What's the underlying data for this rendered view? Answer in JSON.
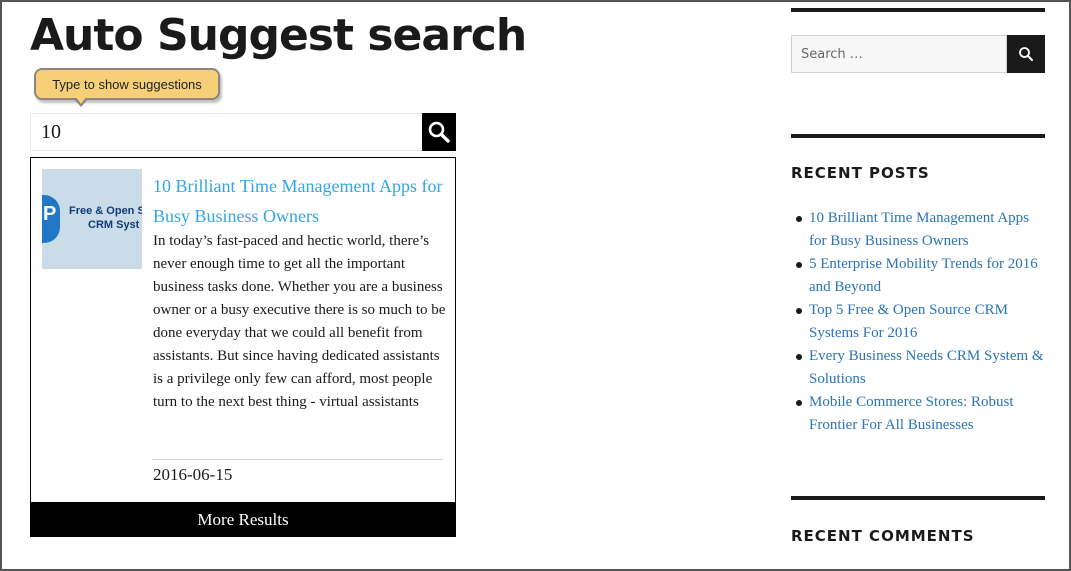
{
  "page": {
    "title": "Auto Suggest search",
    "tooltip": "Type to show suggestions"
  },
  "search": {
    "value": "10",
    "button_icon": "search-icon"
  },
  "results": {
    "items": [
      {
        "title": "10 Brilliant Time Management Apps for Busy Business Owners",
        "excerpt": "In today’s fast-paced and hectic world, there’s never enough time to get all the important business tasks done. Whether you are a business owner or a busy executive there is so much to be done everyday that we could all benefit from assistants. But since having dedicated assistants is a privilege only few can afford, most people turn to the next best thing - virtual assistants",
        "date": "2016-06-15",
        "thumbnail_text": [
          "P",
          "Free & Open S",
          "CRM Syst"
        ]
      }
    ],
    "more_label": "More Results"
  },
  "sidebar": {
    "search_placeholder": "Search …",
    "recent_posts_heading": "RECENT POSTS",
    "recent_posts": [
      "10 Brilliant Time Management Apps for Busy Business Owners",
      "5 Enterprise Mobility Trends for 2016 and Beyond",
      "Top 5 Free & Open Source CRM Systems For 2016",
      "Every Business Needs CRM System & Solutions",
      "Mobile Commerce Stores: Robust Frontier For All Businesses"
    ],
    "recent_comments_heading": "RECENT COMMENTS"
  },
  "colors": {
    "link": "#2a74b8",
    "result_title": "#32a6e6",
    "tooltip_bg": "#f6cf78",
    "dark": "#1a1a1a"
  }
}
